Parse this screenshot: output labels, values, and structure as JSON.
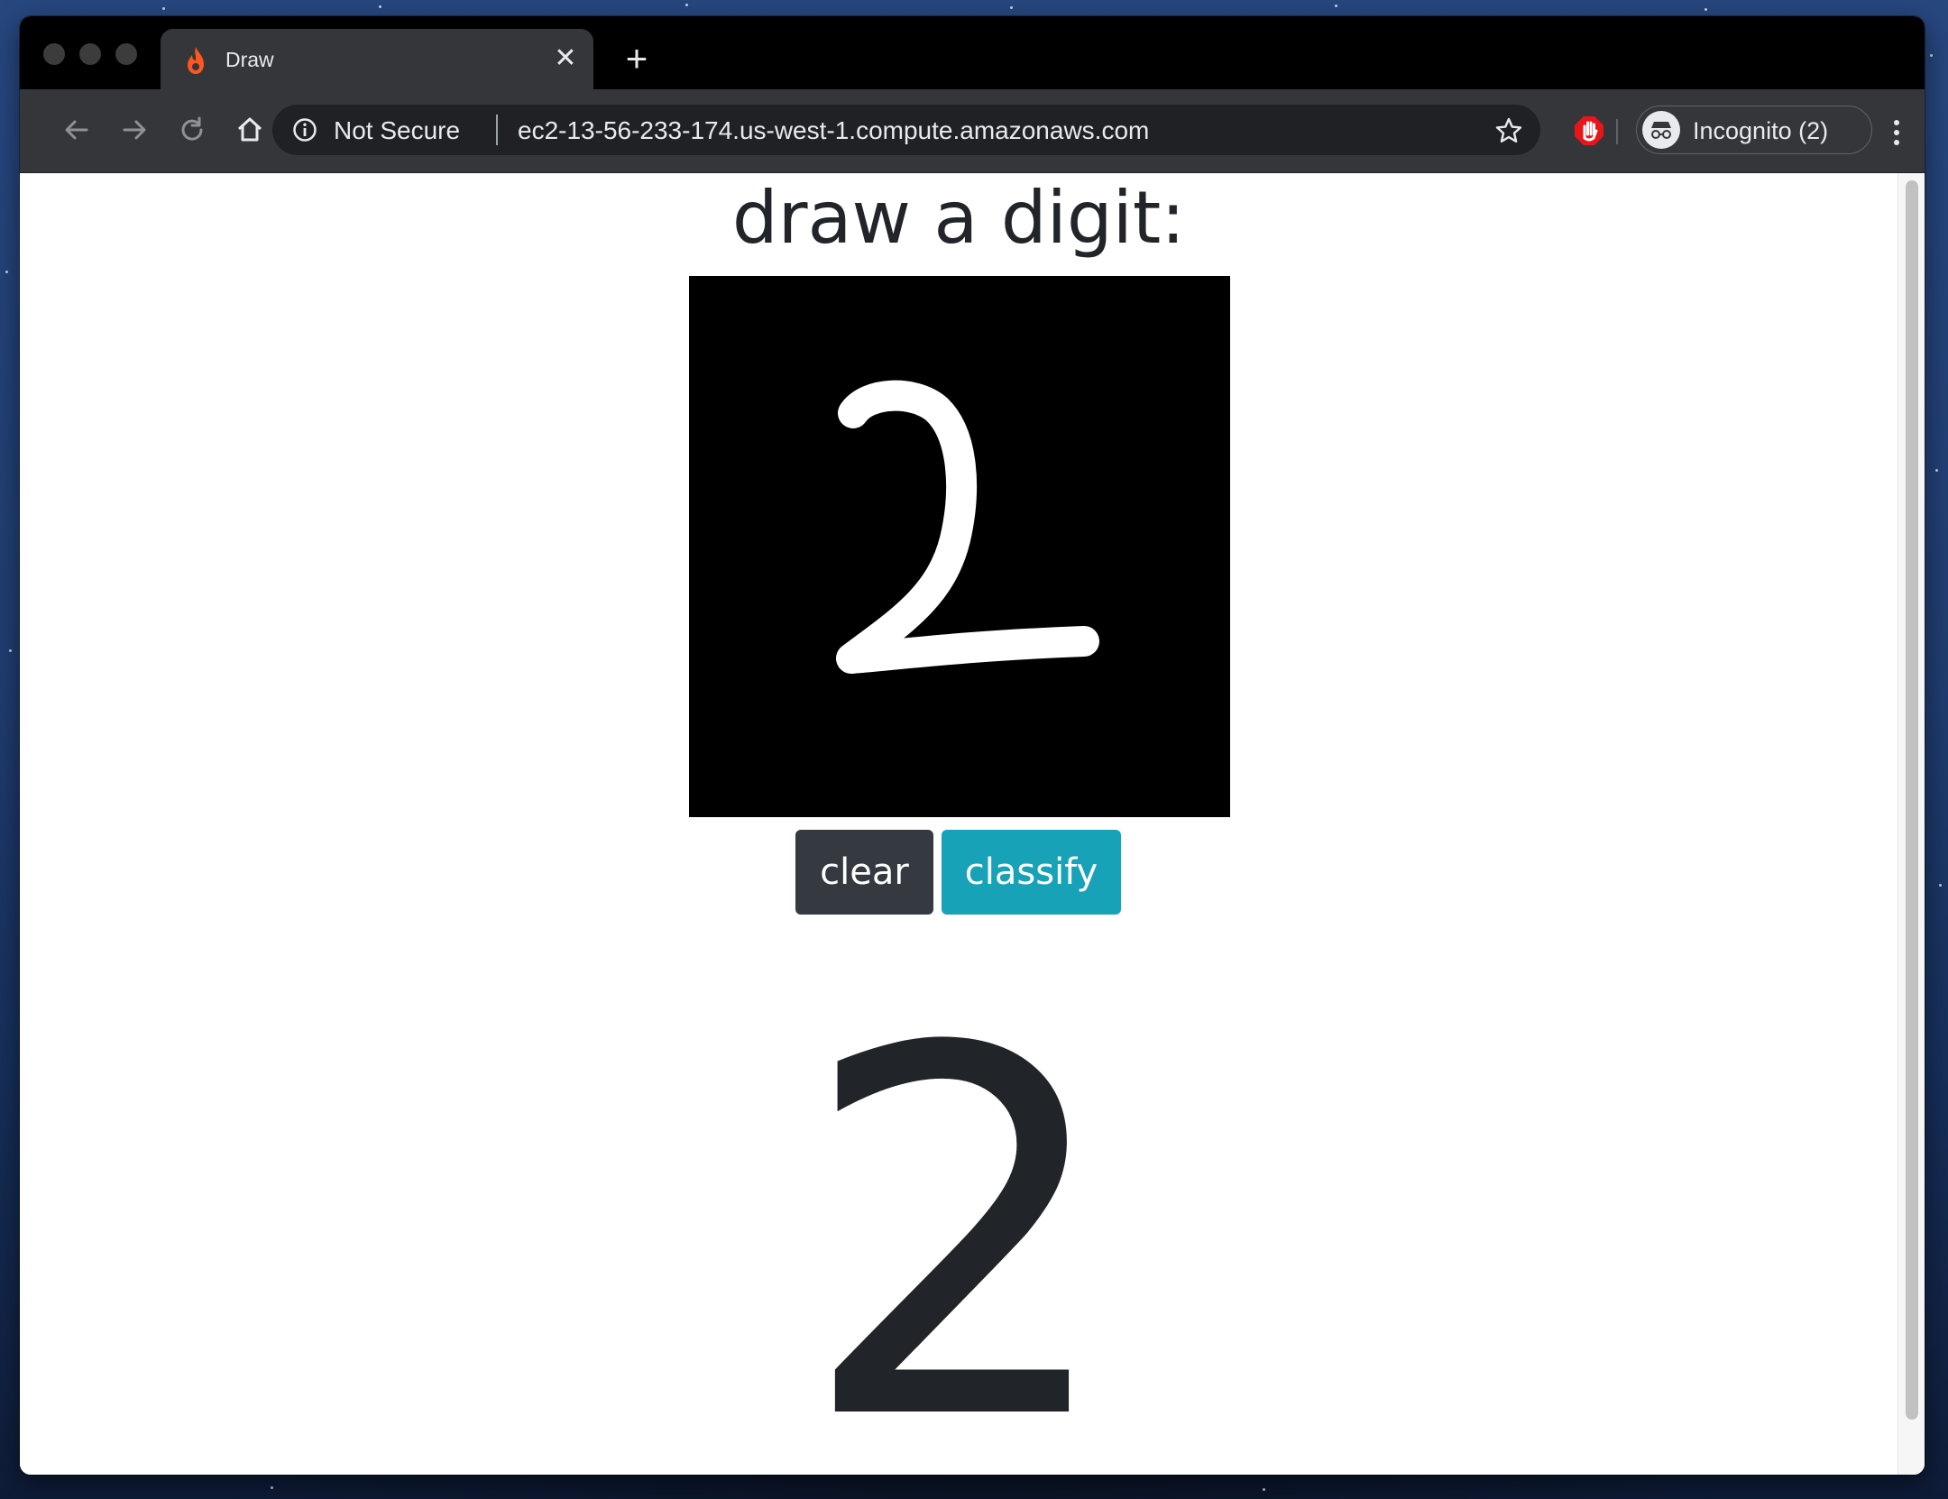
{
  "browser": {
    "tab": {
      "title": "Draw",
      "favicon": "flame-icon",
      "close_icon": "close-icon"
    },
    "new_tab_icon": "plus-icon",
    "toolbar": {
      "back_icon": "arrow-left-icon",
      "forward_icon": "arrow-right-icon",
      "reload_icon": "reload-icon",
      "home_icon": "home-icon",
      "security_label": "Not Secure",
      "url": "ec2-13-56-233-174.us-west-1.compute.amazonaws.com",
      "bookmark_icon": "star-icon",
      "extension_icon": "hand-stop-icon",
      "profile_label": "Incognito (2)",
      "menu_icon": "kebab-menu-icon"
    }
  },
  "page": {
    "heading": "draw a digit:",
    "canvas": {
      "drawn_digit": "2",
      "background": "#000000",
      "stroke": "#ffffff"
    },
    "buttons": {
      "clear": "clear",
      "classify": "classify"
    },
    "prediction": "2"
  },
  "colors": {
    "clear_button": "#343a40",
    "classify_button": "#17a2b8",
    "text": "#212529"
  }
}
